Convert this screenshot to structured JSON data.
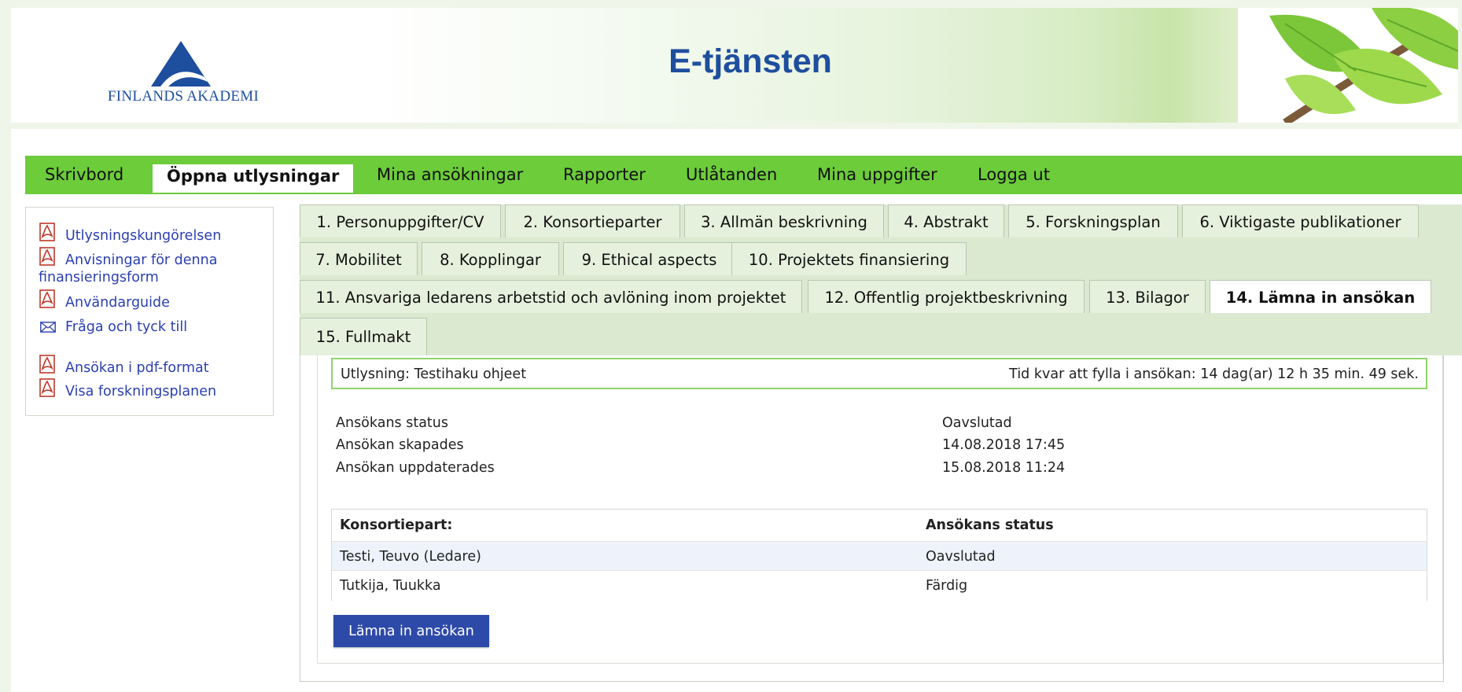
{
  "header": {
    "logo_text": "FINLANDS AKADEMI",
    "title": "E-tjänsten"
  },
  "nav": {
    "items": [
      {
        "label": "Skrivbord"
      },
      {
        "label": "Öppna utlysningar",
        "active": true
      },
      {
        "label": "Mina ansökningar"
      },
      {
        "label": "Rapporter"
      },
      {
        "label": "Utlåtanden"
      },
      {
        "label": "Mina uppgifter"
      },
      {
        "label": "Logga ut"
      }
    ]
  },
  "sidebar": {
    "links": [
      {
        "label": "Utlysningskungörelsen",
        "icon": "pdf-icon"
      },
      {
        "label_line1": "Anvisningar för denna",
        "label_line2": "finansieringsform",
        "icon": "pdf-icon"
      },
      {
        "label": "Användarguide",
        "icon": "pdf-icon"
      },
      {
        "label": "Fråga och tyck till",
        "icon": "mail-icon"
      },
      {
        "label": "Ansökan i pdf-format",
        "icon": "pdf-icon"
      },
      {
        "label": "Visa forskningsplanen",
        "icon": "pdf-icon"
      }
    ]
  },
  "tabs": [
    {
      "label": "1. Personuppgifter/CV"
    },
    {
      "label": "2. Konsortieparter"
    },
    {
      "label": "3. Allmän beskrivning"
    },
    {
      "label": "4. Abstrakt"
    },
    {
      "label": "5. Forskningsplan"
    },
    {
      "label": "6. Viktigaste publikationer"
    },
    {
      "label": "7. Mobilitet"
    },
    {
      "label": "8. Kopplingar"
    },
    {
      "label": "9. Ethical aspects"
    },
    {
      "label": "10. Projektets finansiering"
    },
    {
      "label": "11. Ansvariga ledarens arbetstid och avlöning inom projektet"
    },
    {
      "label": "12. Offentlig projektbeskrivning"
    },
    {
      "label": "13. Bilagor"
    },
    {
      "label": "14. Lämna in ansökan",
      "active": true
    },
    {
      "label": "15. Fullmakt"
    }
  ],
  "call": {
    "name": "Utlysning: Testihaku ohjeet",
    "time_left": "Tid kvar att fylla i ansökan: 14 dag(ar) 12 h 35 min. 49 sek."
  },
  "info": [
    {
      "label": "Ansökans status",
      "value": "Oavslutad"
    },
    {
      "label": "Ansökan skapades",
      "value": "14.08.2018 17:45"
    },
    {
      "label": "Ansökan uppdaterades",
      "value": "15.08.2018 11:24"
    }
  ],
  "consortium_table": {
    "headers": [
      "Konsortiepart:",
      "Ansökans status"
    ],
    "rows": [
      [
        "Testi, Teuvo (Ledare)",
        "Oavslutad"
      ],
      [
        "Tutkija, Tuukka",
        "Färdig"
      ]
    ]
  },
  "submit_button": "Lämna in ansökan",
  "colors": {
    "nav_green": "#6ccc3a",
    "link_blue": "#2a3fb0",
    "title_blue": "#1e4e9e",
    "button_blue": "#2e4aa8",
    "tab_bg": "#dbe9d1"
  }
}
